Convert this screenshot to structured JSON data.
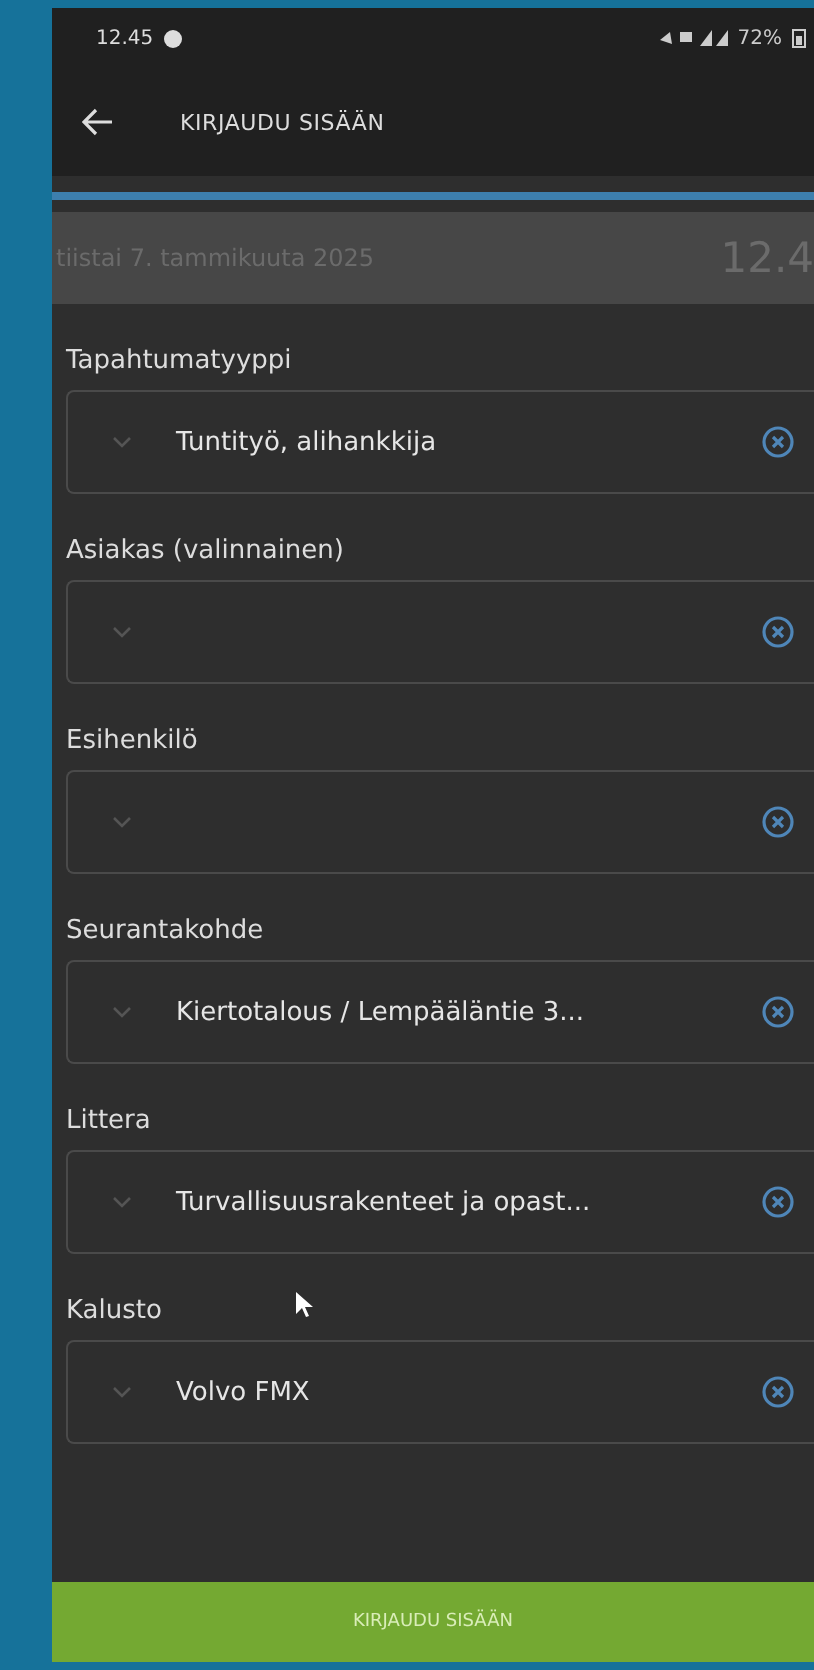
{
  "status_bar": {
    "time": "12.45",
    "battery": "72%"
  },
  "app_bar": {
    "title": "KIRJAUDU SISÄÄN"
  },
  "date_bar": {
    "date": "tiistai 7. tammikuuta 2025",
    "time": "12.4"
  },
  "fields": [
    {
      "label": "Tapahtumatyyppi",
      "value": "Tuntityö, alihankkija"
    },
    {
      "label": "Asiakas (valinnainen)"
    },
    {
      "label": "Esihenkilö"
    },
    {
      "label": "Seurantakohde",
      "value": "Kiertotalous / Lempääläntie 3..."
    },
    {
      "label": "Littera",
      "value": "Turvallisuusrakenteet ja opast..."
    },
    {
      "label": "Kalusto",
      "value": "Volvo FMX"
    }
  ],
  "submit_button": "KIRJAUDU SISÄÄN"
}
